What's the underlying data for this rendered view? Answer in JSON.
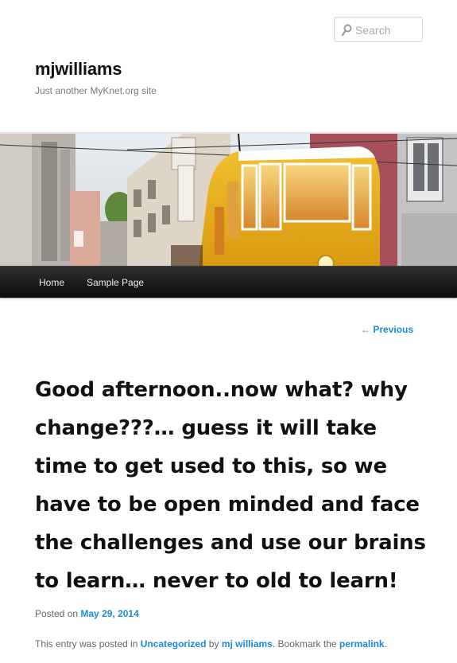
{
  "search": {
    "placeholder": "Search"
  },
  "site": {
    "title": "mjwilliams",
    "description": "Just another MyKnet.org site"
  },
  "nav": {
    "items": [
      {
        "label": "Home"
      },
      {
        "label": "Sample Page"
      }
    ]
  },
  "post_nav": {
    "previous_label": "← Previous"
  },
  "post": {
    "title": "Good afternoon..now what? why change???… guess it will take time to get used to this, so we have to be open minded and face the challenges and use our brains to learn… never to old to learn!",
    "posted_on_label": "Posted on",
    "date": "May 29, 2014",
    "footer": {
      "prefix": "This entry was posted in",
      "category": "Uncategorized",
      "by_label": "by",
      "author": "mj williams",
      "bookmark_text": ". Bookmark the",
      "permalink_label": "permalink",
      "end": "."
    }
  },
  "colors": {
    "link": "#1b8be0",
    "nav_bg": "#111111",
    "tram_yellow": "#e8b020"
  },
  "icons": {
    "search": "search-icon"
  }
}
